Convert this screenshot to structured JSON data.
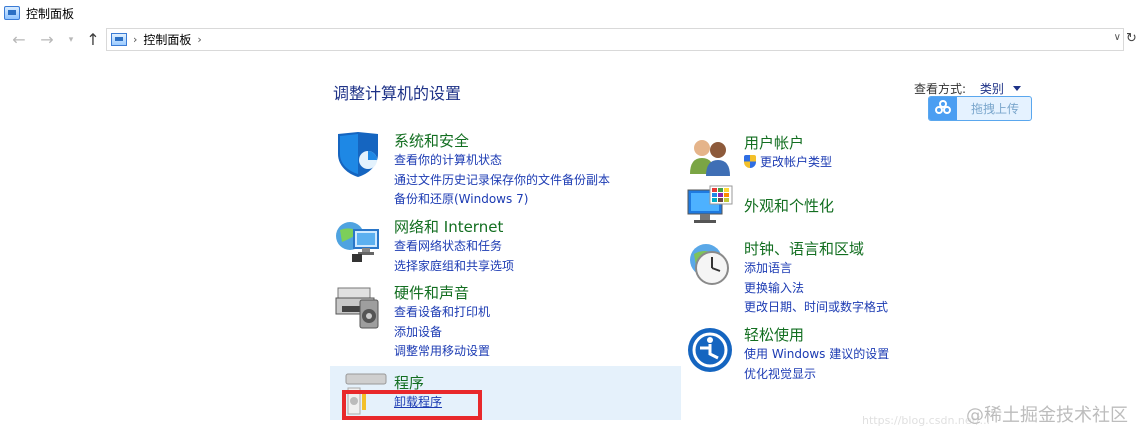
{
  "window": {
    "title": "控制面板"
  },
  "nav": {
    "back_icon": "←",
    "forward_icon": "→",
    "recent_icon": "▾",
    "up_icon": "↑",
    "crumb_sep": "›",
    "breadcrumb": "控制面板",
    "dropdown_icon": "∨",
    "refresh_icon": "↻"
  },
  "main": {
    "title": "调整计算机的设置",
    "view_by_label": "查看方式:",
    "view_by_value": "类别",
    "upload_button": "拖拽上传"
  },
  "categories_left": [
    {
      "title": "系统和安全",
      "links": [
        "查看你的计算机状态",
        "通过文件历史记录保存你的文件备份副本",
        "备份和还原(Windows 7)"
      ]
    },
    {
      "title": "网络和 Internet",
      "links": [
        "查看网络状态和任务",
        "选择家庭组和共享选项"
      ]
    },
    {
      "title": "硬件和声音",
      "links": [
        "查看设备和打印机",
        "添加设备",
        "调整常用移动设置"
      ]
    },
    {
      "title": "程序",
      "links": [
        "卸载程序"
      ]
    }
  ],
  "categories_right": [
    {
      "title": "用户帐户",
      "links": [
        "更改帐户类型"
      ]
    },
    {
      "title": "外观和个性化",
      "links": []
    },
    {
      "title": "时钟、语言和区域",
      "links": [
        "添加语言",
        "更换输入法",
        "更改日期、时间或数字格式"
      ]
    },
    {
      "title": "轻松使用",
      "links": [
        "使用 Windows 建议的设置",
        "优化视觉显示"
      ]
    }
  ],
  "watermark": {
    "text": "@稀土掘金技术社区",
    "url": "https://blog.csdn.net/..."
  },
  "colors": {
    "category_green": "#126e20",
    "link_blue": "#1c3bb3",
    "highlight": "#e5f1fb",
    "annotation_red": "#e8282b"
  }
}
